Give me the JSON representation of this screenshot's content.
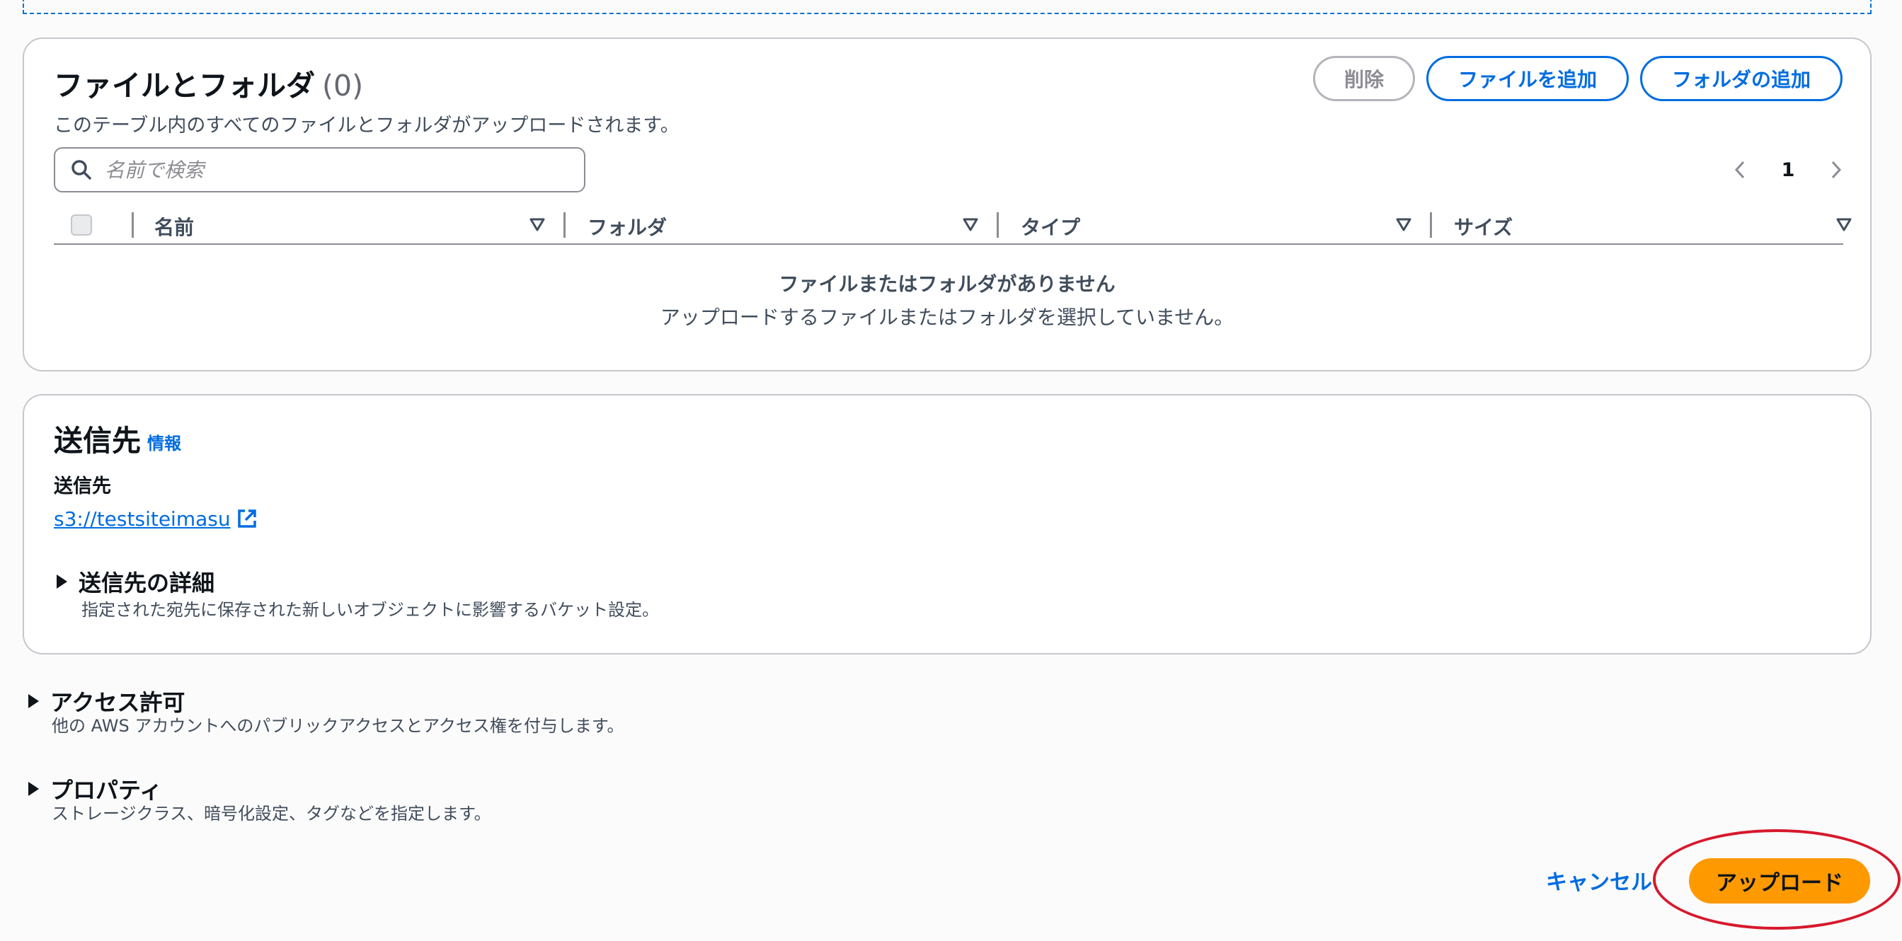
{
  "files_section": {
    "title": "ファイルとフォルダ",
    "count": "(0)",
    "description": "このテーブル内のすべてのファイルとフォルダがアップロードされます。",
    "buttons": {
      "delete": "削除",
      "add_files": "ファイルを追加",
      "add_folder": "フォルダの追加"
    },
    "search": {
      "placeholder": "名前で検索",
      "value": ""
    },
    "pagination": {
      "current_page": "1"
    },
    "columns": [
      "名前",
      "フォルダ",
      "タイプ",
      "サイズ"
    ],
    "empty_state": {
      "title": "ファイルまたはフォルダがありません",
      "description": "アップロードするファイルまたはフォルダを選択していません。"
    }
  },
  "destination_section": {
    "title": "送信先",
    "info_link": "情報",
    "label": "送信先",
    "link": "s3://testsiteimasu",
    "details": {
      "title": "送信先の詳細",
      "description": "指定された宛先に保存された新しいオブジェクトに影響するバケット設定。"
    }
  },
  "access_section": {
    "title": "アクセス許可",
    "description": "他の AWS アカウントへのパブリックアクセスとアクセス権を付与します。"
  },
  "properties_section": {
    "title": "プロパティ",
    "description": "ストレージクラス、暗号化設定、タグなどを指定します。"
  },
  "footer": {
    "cancel": "キャンセル",
    "upload": "アップロード"
  },
  "colors": {
    "link_blue": "#006ce0",
    "primary_orange": "#ff9900",
    "highlight_red": "#d7192c"
  }
}
